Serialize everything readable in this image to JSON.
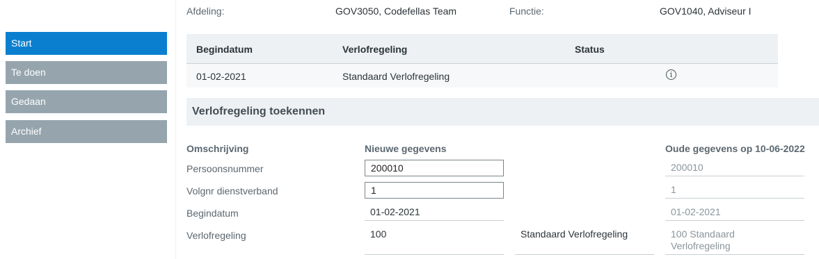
{
  "sidebar": {
    "items": [
      {
        "label": "Start",
        "active": true
      },
      {
        "label": "Te doen",
        "active": false
      },
      {
        "label": "Gedaan",
        "active": false
      },
      {
        "label": "Archief",
        "active": false
      }
    ]
  },
  "header": {
    "afdeling_label": "Afdeling:",
    "afdeling_value": "GOV3050, Codefellas Team",
    "functie_label": "Functie:",
    "functie_value": "GOV1040, Adviseur I"
  },
  "table": {
    "columns": [
      "Begindatum",
      "Verlofregeling",
      "Status"
    ],
    "rows": [
      {
        "begindatum": "01-02-2021",
        "verlofregeling": "Standaard Verlofregeling",
        "status_icon": "info-icon"
      }
    ]
  },
  "section": {
    "title": "Verlofregeling toekennen"
  },
  "form": {
    "headers": {
      "omschrijving": "Omschrijving",
      "nieuwe": "Nieuwe gegevens",
      "oude": "Oude gegevens op 10-06-2022"
    },
    "rows": [
      {
        "label": "Persoonsnummer",
        "new_value": "200010",
        "old_value": "200010"
      },
      {
        "label": "Volgnr dienstverband",
        "new_value": "1",
        "old_value": "1"
      },
      {
        "label": "Begindatum",
        "new_value": "01-02-2021",
        "old_value": "01-02-2021"
      },
      {
        "label": "Verlofregeling",
        "new_value": "100",
        "new_description": "Standaard Verlofregeling",
        "old_value": "100 Standaard Verlofregeling"
      }
    ]
  },
  "colors": {
    "active_nav": "#0b7fcf",
    "inactive_nav": "#96a5ad",
    "header_bg": "#eef1f3"
  }
}
